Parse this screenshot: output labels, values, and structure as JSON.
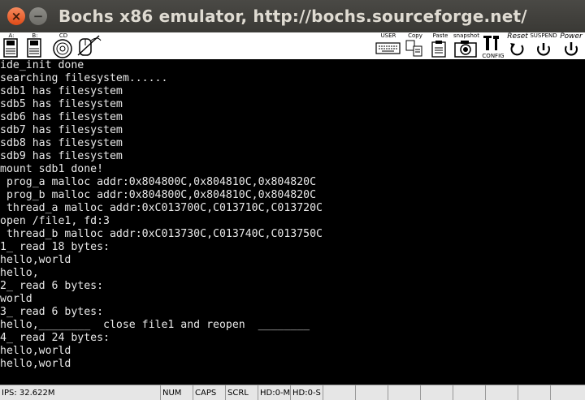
{
  "window": {
    "title": "Bochs x86 emulator, http://bochs.sourceforge.net/",
    "close_glyph": "×",
    "minimize_glyph": "−"
  },
  "toolbar": {
    "floppy_a_label": "A:",
    "floppy_b_label": "B:",
    "cdrom_label": "CD",
    "user_label": "USER",
    "copy_label": "Copy",
    "paste_label": "Paste",
    "snapshot_label": "snapshot",
    "config_label": "CONFIG",
    "reset_label": "Reset",
    "suspend_label": "SUSPEND",
    "power_label": "Power"
  },
  "console": {
    "lines": [
      "ide_init done",
      "searching filesystem......",
      "sdb1 has filesystem",
      "sdb5 has filesystem",
      "sdb6 has filesystem",
      "sdb7 has filesystem",
      "sdb8 has filesystem",
      "sdb9 has filesystem",
      "mount sdb1 done!",
      " prog_a malloc addr:0x804800C,0x804810C,0x804820C",
      " prog_b malloc addr:0x804800C,0x804810C,0x804820C",
      " thread_a malloc addr:0xC013700C,C013710C,C013720C",
      "open /file1, fd:3",
      " thread_b malloc addr:0xC013730C,C013740C,C013750C",
      "1_ read 18 bytes:",
      "hello,world",
      "hello,",
      "2_ read 6 bytes:",
      "world",
      "3_ read 6 bytes:",
      "hello,________  close file1 and reopen  ________",
      "4_ read 24 bytes:",
      "hello,world",
      "hello,world"
    ]
  },
  "statusbar": {
    "ips": "IPS: 32.622M",
    "num": "NUM",
    "caps": "CAPS",
    "scrl": "SCRL",
    "hd0m": "HD:0-M",
    "hd0s": "HD:0-S"
  },
  "colors": {
    "titlebar": "#3c3b37",
    "close_button": "#e9541f",
    "console_bg": "#000000",
    "console_fg": "#e8e8e8"
  }
}
